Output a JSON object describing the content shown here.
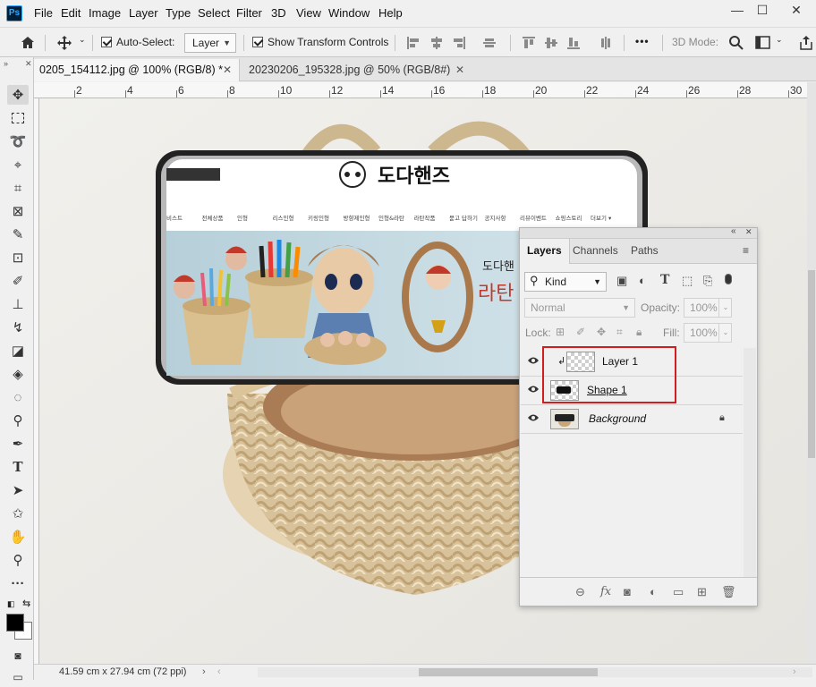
{
  "app": {
    "logo": "Ps"
  },
  "menu": [
    "File",
    "Edit",
    "Image",
    "Layer",
    "Type",
    "Select",
    "Filter",
    "3D",
    "View",
    "Window",
    "Help"
  ],
  "window_controls": {
    "minimize": "—",
    "restore": "☐",
    "close": "✕"
  },
  "options": {
    "auto_select_label": "Auto-Select:",
    "auto_select_value": "Layer",
    "show_transform_label": "Show Transform Controls",
    "mode_3d_label": "3D Mode:",
    "more": "•••"
  },
  "doc_tabs": [
    {
      "label": "0205_154112.jpg @ 100% (RGB/8) *",
      "active": true
    },
    {
      "label": "20230206_195328.jpg @ 50% (RGB/8#)",
      "active": false
    }
  ],
  "ruler_numbers": [
    "2",
    "4",
    "6",
    "8",
    "10",
    "12",
    "14",
    "16",
    "18",
    "20",
    "22",
    "24",
    "26",
    "28",
    "30"
  ],
  "status": {
    "document_size": "41.59 cm x 27.94 cm (72 ppi)"
  },
  "canvas_content": {
    "brand_name": "도다핸즈",
    "promo_text_1": "도다핸",
    "promo_text_2": "라탄",
    "nav_items": [
      "비스트",
      "전체상품",
      "인형",
      "리스인형",
      "키링인형",
      "방향제인형",
      "인형&라탄",
      "라탄작품",
      "묻고 답하기",
      "공지사항",
      "리뷰이벤트",
      "쇼핑스토리",
      "더보기 ▾"
    ]
  },
  "layers_panel": {
    "tabs": [
      "Layers",
      "Channels",
      "Paths"
    ],
    "filter_value": "Kind",
    "blend_mode": "Normal",
    "opacity_label": "Opacity:",
    "opacity_value": "100%",
    "lock_label": "Lock:",
    "fill_label": "Fill:",
    "fill_value": "100%",
    "layers": [
      {
        "name": "Layer 1",
        "clipped": true,
        "visible": true
      },
      {
        "name": "Shape 1",
        "clipped": false,
        "visible": true
      },
      {
        "name": "Background",
        "clipped": false,
        "visible": true,
        "locked": true
      }
    ]
  },
  "colors": {
    "highlight": "#d11d1d",
    "ps_blue": "#31a8ff"
  }
}
